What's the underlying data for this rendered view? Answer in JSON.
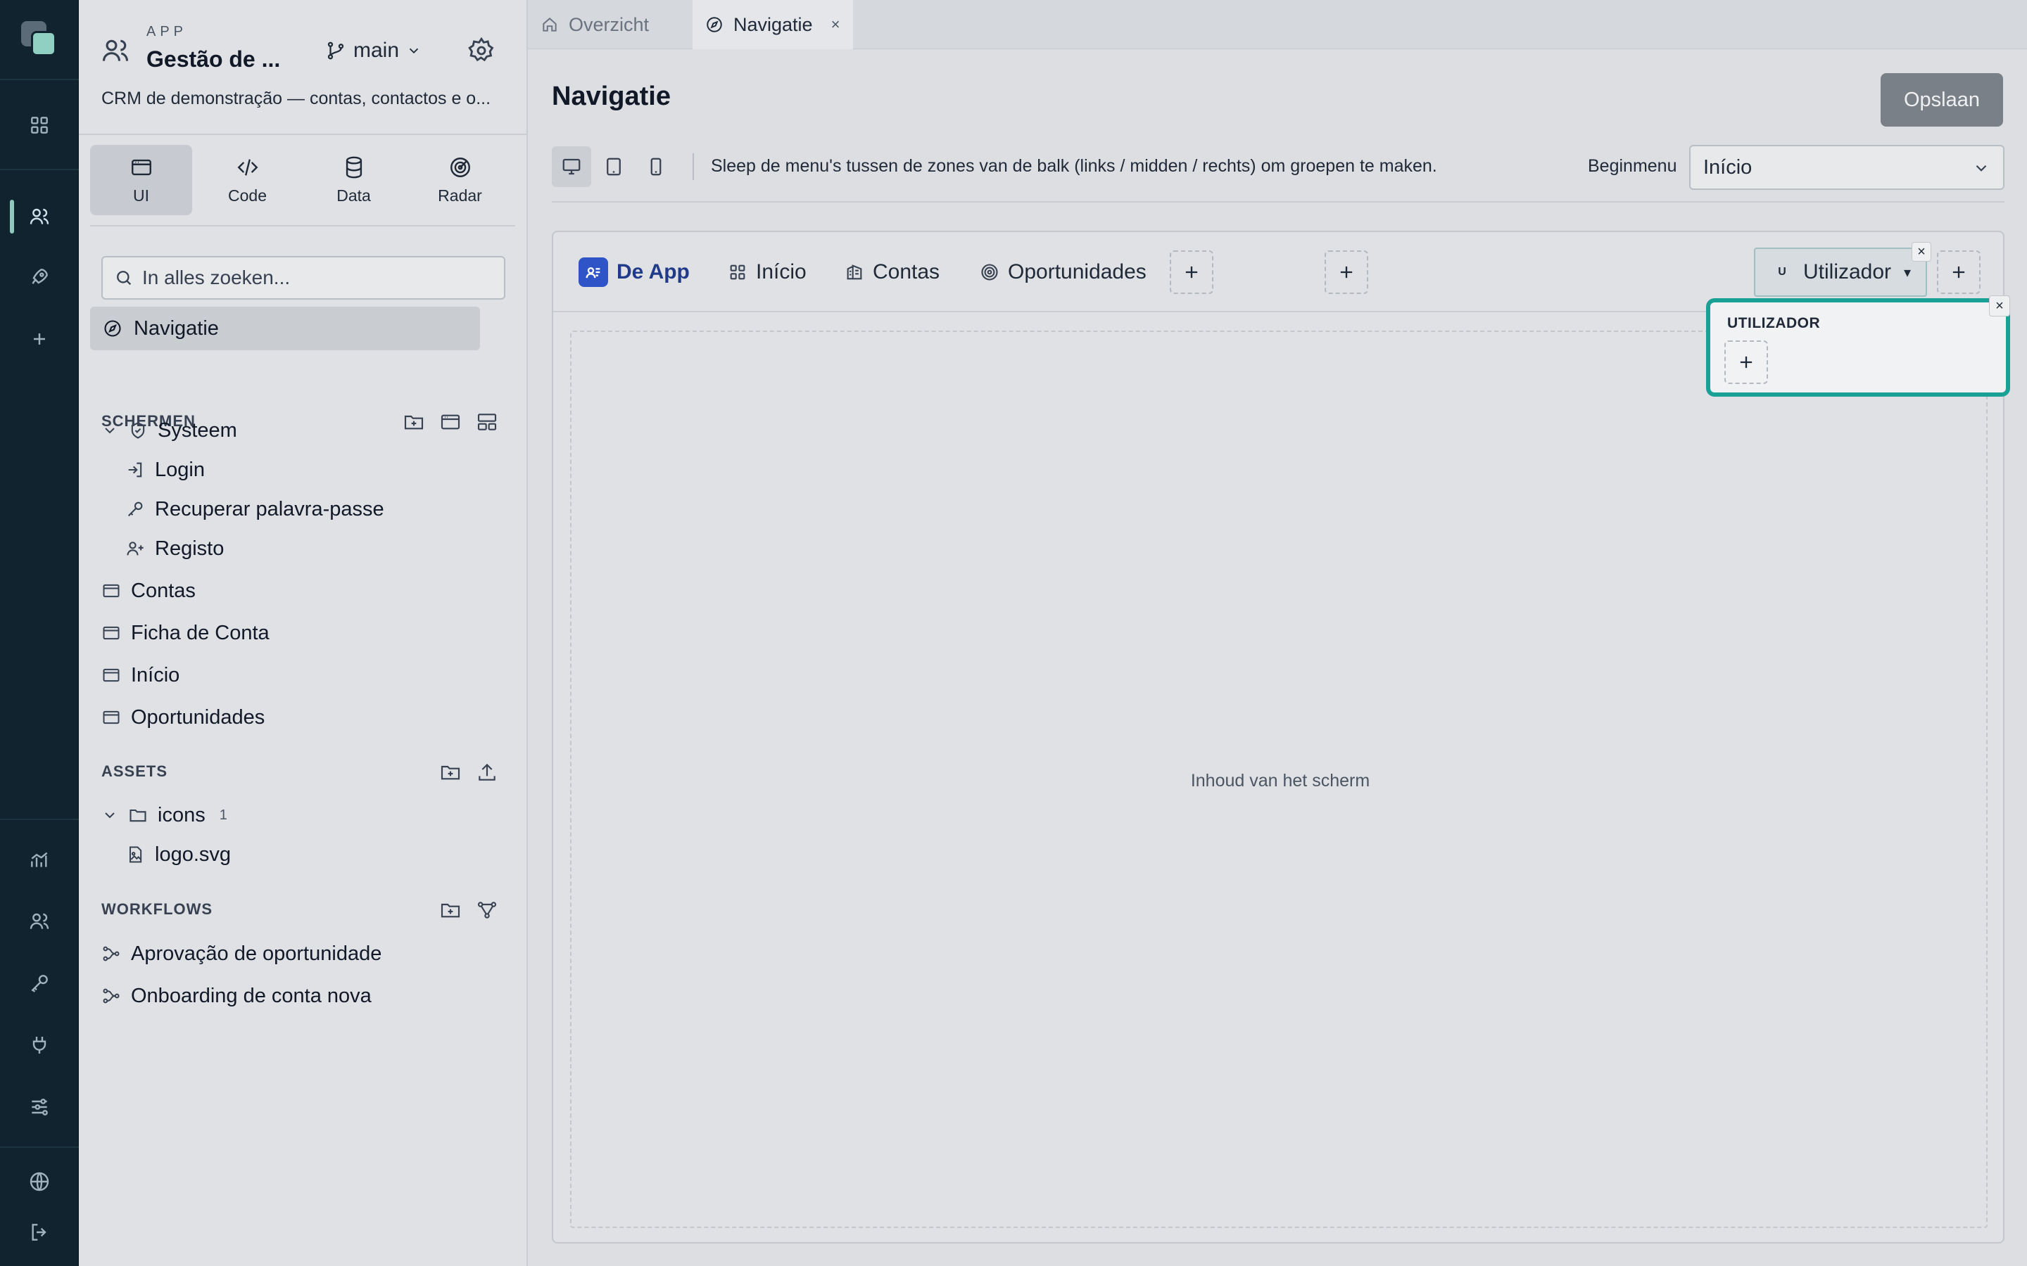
{
  "app": {
    "kicker": "APP",
    "title": "Gestão de ...",
    "branch": "main",
    "description": "CRM de demonstração — contas, contactos e o..."
  },
  "modes": [
    {
      "label": "UI",
      "icon": "window-icon",
      "active": true
    },
    {
      "label": "Code",
      "icon": "code-icon",
      "active": false
    },
    {
      "label": "Data",
      "icon": "database-icon",
      "active": false
    },
    {
      "label": "Radar",
      "icon": "radar-icon",
      "active": false
    }
  ],
  "search": {
    "placeholder": "In alles zoeken..."
  },
  "nav_active": "Navigatie",
  "sections": {
    "screens": "SCHERMEN",
    "assets": "ASSETS",
    "workflows": "WORKFLOWS"
  },
  "tree": {
    "system_folder": "Systeem",
    "system_children": [
      "Login",
      "Recuperar palavra-passe",
      "Registo"
    ],
    "screens": [
      "Contas",
      "Ficha de Conta",
      "Início",
      "Oportunidades"
    ],
    "assets_folder": "icons",
    "assets_folder_count": "1",
    "assets_files": [
      "logo.svg"
    ],
    "workflows": [
      "Aprovação de oportunidade",
      "Onboarding de conta nova"
    ]
  },
  "tabs": [
    {
      "label": "Overzicht",
      "icon": "home-icon",
      "active": false
    },
    {
      "label": "Navigatie",
      "icon": "compass-icon",
      "active": true,
      "close": "×"
    }
  ],
  "page": {
    "title": "Navigatie",
    "save_label": "Opslaan",
    "hint": "Sleep de menu's tussen de zones van de balk (links / midden / rechts) om groepen te maken.",
    "begin_label": "Beginmenu",
    "begin_value": "Início"
  },
  "navbar": {
    "brand": "De App",
    "items": [
      {
        "label": "Início",
        "icon": "grid-icon"
      },
      {
        "label": "Contas",
        "icon": "building-icon"
      },
      {
        "label": "Oportunidades",
        "icon": "target-icon"
      }
    ],
    "user_initial": "U",
    "user_label": "Utilizador",
    "close": "×"
  },
  "content_placeholder": "Inhoud van het scherm",
  "popover": {
    "title": "UTILIZADOR",
    "close": "×"
  },
  "colors": {
    "rail_bg": "#10232f",
    "accent_teal": "#1aa196",
    "brand_blue": "#2f54c8",
    "save_button": "#7a8087"
  }
}
